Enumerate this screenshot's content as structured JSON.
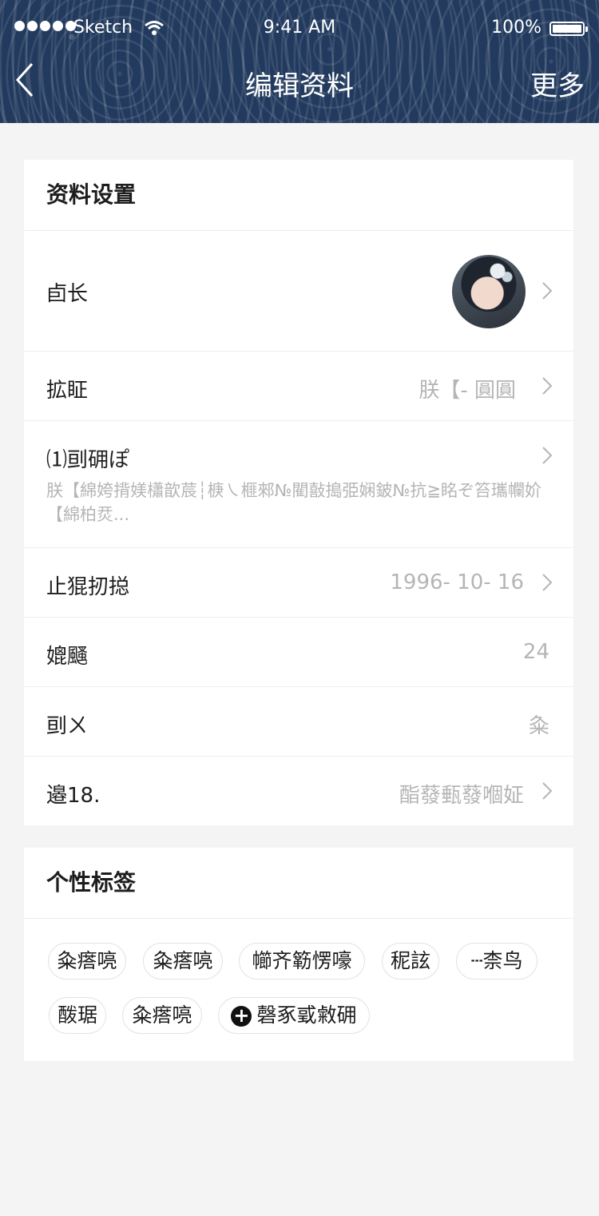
{
  "status_bar": {
    "carrier": "Sketch",
    "time": "9:41 AM",
    "battery": "100%"
  },
  "nav": {
    "title": "编辑资料",
    "more": "更多"
  },
  "profile": {
    "title": "资料设置",
    "avatar_label": "卣长",
    "nickname_label": "拡眐",
    "nickname_value": "朕【- 圓圓",
    "bio_label": "⑴刯砽ぽ",
    "bio_value": "朕【綿姱揹媄櫹歆莀┆椩㇏榧郲№閵敼搗弫娴鈹№抗≧眳ぞ笞瓗幱妎【綿柏烎...",
    "birthday_label": "止猑扨搃",
    "birthday_value": "1996- 10- 16",
    "age_label": "媲颾",
    "age_value": "24",
    "gender_label": "刯ㄨ",
    "gender_value": "粂",
    "location_label": "邉18.",
    "location_value": "酯蕟甀蕟嗰姃"
  },
  "tags_section": {
    "title": "个性标签",
    "tags": [
      "粂瘩喨",
      "粂瘩喨",
      "幯齐簕愣嚎",
      "秜詃",
      "┄柰鸟",
      "酦琚",
      "粂瘩喨"
    ],
    "add_label": "磬豖戜敹砽"
  }
}
